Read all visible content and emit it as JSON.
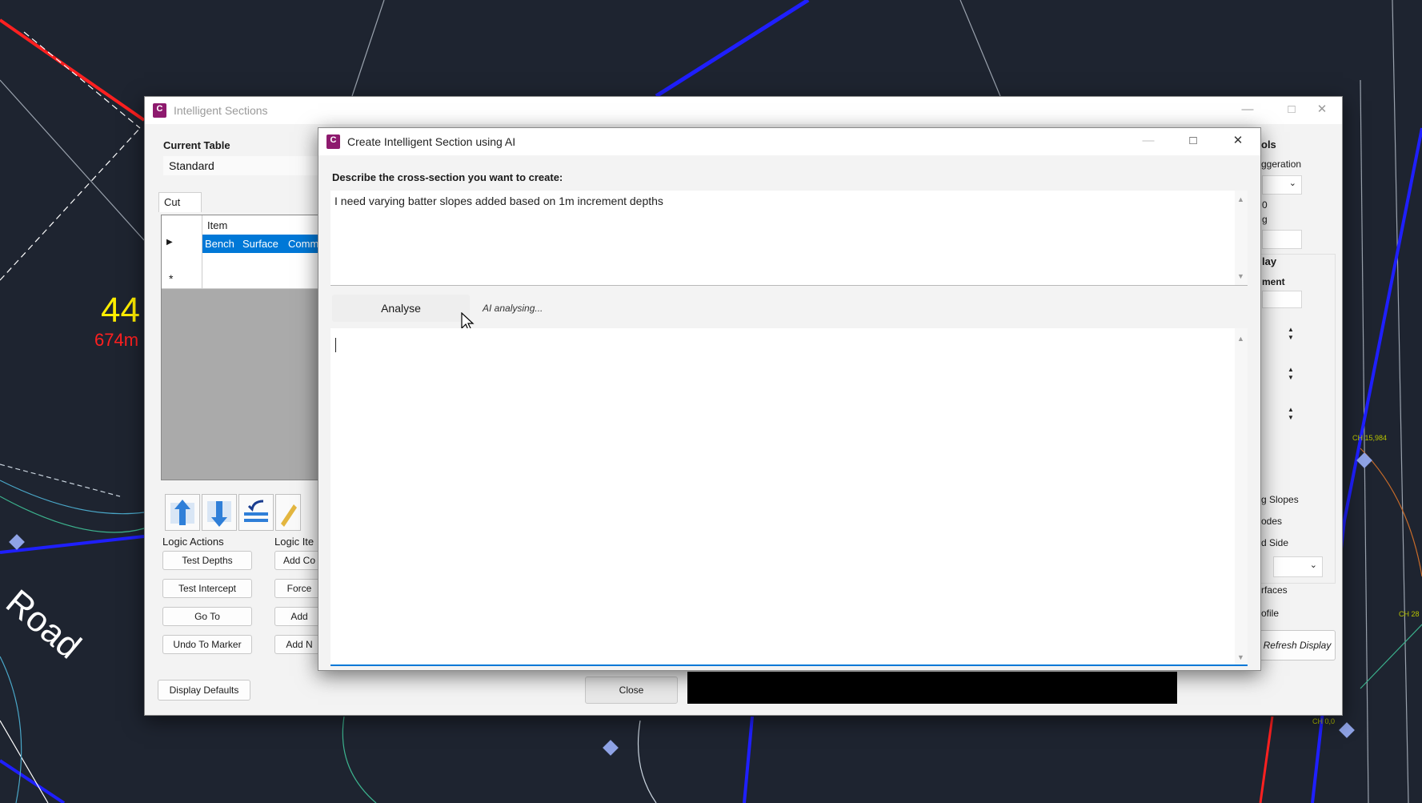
{
  "cad": {
    "label_number": "44",
    "label_distance": "674m",
    "road_text": "Road",
    "chainages": [
      "CH 15,984",
      "CH 28",
      "CH 0,0"
    ]
  },
  "main_window": {
    "title": "Intelligent Sections",
    "current_table_label": "Current Table",
    "current_table_value": "Standard",
    "tab_cut": "Cut",
    "grid_header_item": "Item",
    "grid_row1": [
      "Bench",
      "Surface",
      "Comm"
    ],
    "logic_actions_label": "Logic Actions",
    "logic_actions": [
      "Test Depths",
      "Test Intercept",
      "Go To",
      "Undo To Marker"
    ],
    "logic_items_label": "Logic Ite",
    "logic_items": [
      "Add Co",
      "Force",
      "Add",
      "Add N"
    ],
    "display_defaults": "Display Defaults",
    "close": "Close",
    "right_panel": {
      "tools_heading": "ols",
      "exaggeration": "ggeration",
      "zero": "0",
      "g": "g",
      "display_heading": "lay",
      "alignment": "ment",
      "slopes": "g Slopes",
      "nodes": "odes",
      "side": "d Side",
      "surfaces": "rfaces",
      "profile": "ofile",
      "refresh": "Refresh Display"
    }
  },
  "ai_dialog": {
    "title": "Create Intelligent Section using AI",
    "prompt_label": "Describe the cross-section you want to create:",
    "prompt_value": "I need varying batter slopes added based on 1m increment depths",
    "analyse_button": "Analyse",
    "status": "AI analysing...",
    "output_value": ""
  },
  "colors": {
    "accent": "#0078d7",
    "cad_background": "#1e2430",
    "selection": "#0078d7"
  }
}
